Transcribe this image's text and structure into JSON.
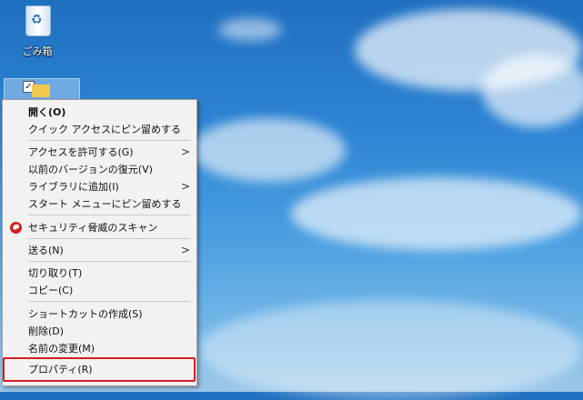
{
  "desktop": {
    "recycle_bin_label": "ごみ箱"
  },
  "context_menu": {
    "items": [
      {
        "label": "開く(O)",
        "bold": true
      },
      {
        "label": "クイック アクセスにピン留めする"
      },
      {
        "label": "アクセスを許可する(G)",
        "submenu": true
      },
      {
        "label": "以前のバージョンの復元(V)"
      },
      {
        "label": "ライブラリに追加(I)",
        "submenu": true
      },
      {
        "label": "スタート メニューにピン留めする"
      },
      {
        "label": "セキュリティ脅威のスキャン",
        "icon": "security-scan-icon"
      },
      {
        "label": "送る(N)",
        "submenu": true
      },
      {
        "label": "切り取り(T)"
      },
      {
        "label": "コピー(C)"
      },
      {
        "label": "ショートカットの作成(S)"
      },
      {
        "label": "削除(D)"
      },
      {
        "label": "名前の変更(M)"
      },
      {
        "label": "プロパティ(R)",
        "highlighted": true
      }
    ],
    "highlight_color": "#d01f25"
  }
}
